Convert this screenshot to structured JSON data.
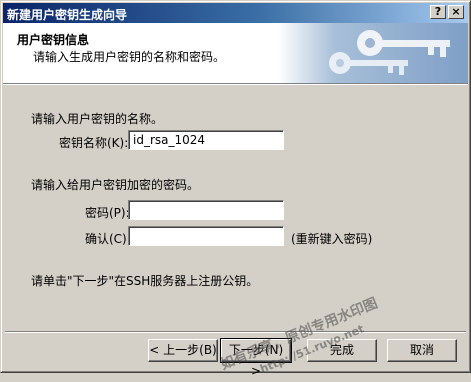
{
  "window": {
    "title": "新建用户密钥生成向导",
    "help_button": "?",
    "close_button": "×"
  },
  "header": {
    "title": "用户密钥信息",
    "subtitle": "请输入生成用户密钥的名称和密码。"
  },
  "name_section": {
    "prompt": "请输入用户密钥的名称。",
    "key_name_label": "密钥名称(K):",
    "key_name_value": "id_rsa_1024"
  },
  "password_section": {
    "prompt": "请输入给用户密钥加密的密码。",
    "password_label": "密码(P):",
    "password_value": "",
    "confirm_label": "确认(C):",
    "confirm_value": "",
    "confirm_hint": "(重新键入密码)"
  },
  "instruction": "请单击\"下一步\"在SSH服务器上注册公钥。",
  "buttons": {
    "back": "< 上一步(B)",
    "next": "下一步(N) >",
    "finish": "完成",
    "cancel": "取消"
  },
  "watermark": {
    "line1": "如有乐享，原创专用水印图",
    "line2": "http://51.ruyo.net"
  },
  "colors": {
    "titlebar_start": "#0a246a",
    "titlebar_end": "#a6caf0",
    "face": "#d4d0c8"
  }
}
